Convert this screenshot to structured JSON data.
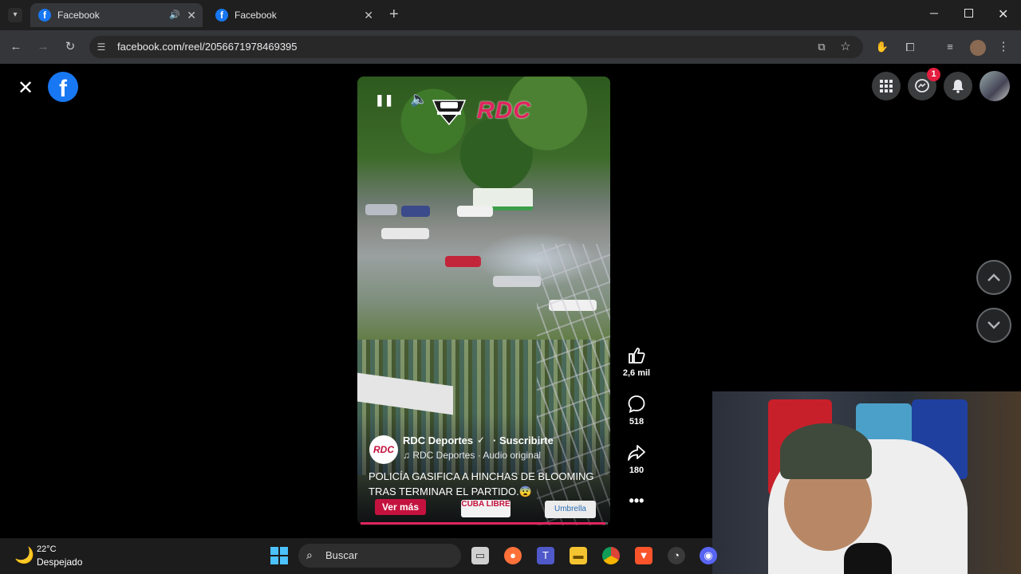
{
  "browser": {
    "tabs": [
      {
        "title": "Facebook",
        "active": true,
        "audio": true
      },
      {
        "title": "Facebook",
        "active": false,
        "audio": false
      }
    ],
    "url": "facebook.com/reel/2056671978469395",
    "new_tab": "+"
  },
  "facebook": {
    "logo": "f",
    "notification_count": "1"
  },
  "reel": {
    "brand_overlay": "RDC",
    "channel_avatar": "RDC",
    "channel_name": "RDC Deportes",
    "subscribe": "· Suscribirte",
    "audio": "♫ RDC Deportes · Audio original",
    "caption": "POLICÍA GASIFICA A HINCHAS DE BLOOMING TRAS TERMINAR EL PARTIDO.😨",
    "see_more": "Ver más",
    "sponsor_1": "CUBA LIBRE",
    "sponsor_2": "Umbrella",
    "progress": 0.99,
    "accent_color": "#e0245e"
  },
  "actions": {
    "likes": "2,6 mil",
    "comments": "518",
    "shares": "180"
  },
  "taskbar": {
    "temperature": "22°C",
    "weather": "Despejado",
    "search_placeholder": "Buscar"
  }
}
